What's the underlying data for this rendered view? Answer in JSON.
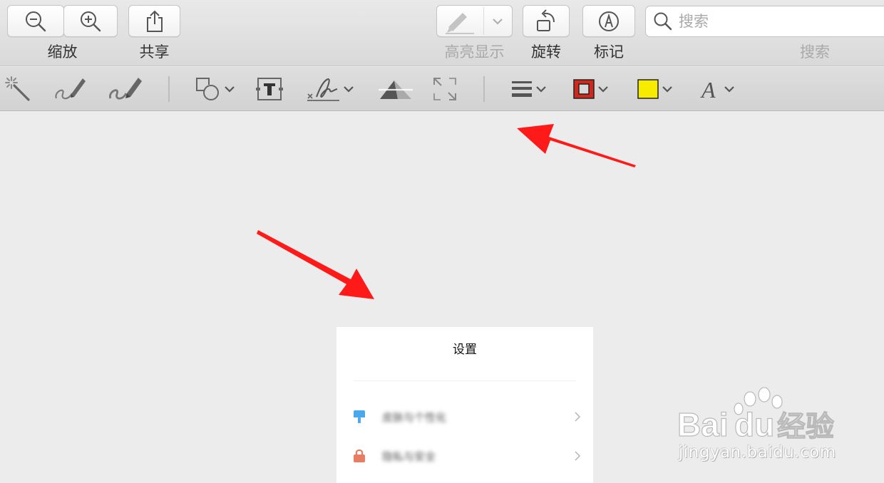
{
  "toolbar": {
    "zoom_label": "缩放",
    "share_label": "共享",
    "highlight_label": "高亮显示",
    "rotate_label": "旋转",
    "markup_label": "标记",
    "search_label": "搜索",
    "search_placeholder": "搜索"
  },
  "markup_toolbar": {
    "border_color": "#d0281c",
    "fill_color": "#f7ec00"
  },
  "document": {
    "title": "设置",
    "rows": [
      {
        "text": "皮肤与个性化",
        "icon": "brush-icon",
        "icon_color": "#4aa8ee"
      },
      {
        "text": "隐私与安全",
        "icon": "lock-icon",
        "icon_color": "#ea7c63"
      }
    ]
  },
  "watermark": {
    "url": "jingyan.baidu.com"
  },
  "annotations": {
    "arrow_color": "#ff1a1a"
  }
}
